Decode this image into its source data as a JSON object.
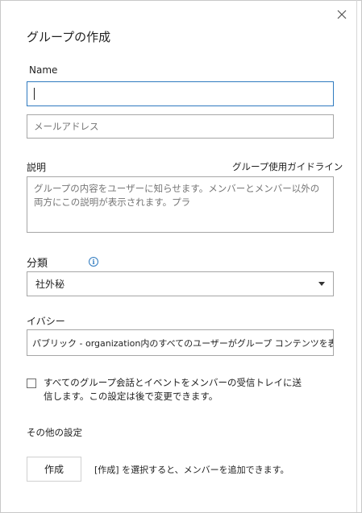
{
  "dialog": {
    "title": "グループの作成",
    "close_icon": "close-icon"
  },
  "name_field": {
    "label": "Name",
    "value": ""
  },
  "email_field": {
    "placeholder": "メールアドレス",
    "value": ""
  },
  "description": {
    "label": "説明",
    "guidelines_link": "グループ使用ガイドライン",
    "placeholder": "グループの内容をユーザーに知らせます。メンバーとメンバー以外の両方にこの説明が表示されます。プラ"
  },
  "classification": {
    "label": "分類",
    "info_icon": "info-icon",
    "selected": "社外秘"
  },
  "privacy": {
    "label": "イバシー",
    "selected": "パブリック - organization内のすべてのユーザーがグループ コンテンツを表示できます。"
  },
  "subscribe": {
    "checked": false,
    "label": "すべてのグループ会話とイベントをメンバーの受信トレイに送信します。この設定は後で変更できます。"
  },
  "more_settings": {
    "label": "その他の設定"
  },
  "footer": {
    "create_label": "作成",
    "hint": "[作成] を選択すると、メンバーを追加できます。"
  },
  "colors": {
    "accent": "#2f7abf",
    "border": "#a6a6a6"
  }
}
